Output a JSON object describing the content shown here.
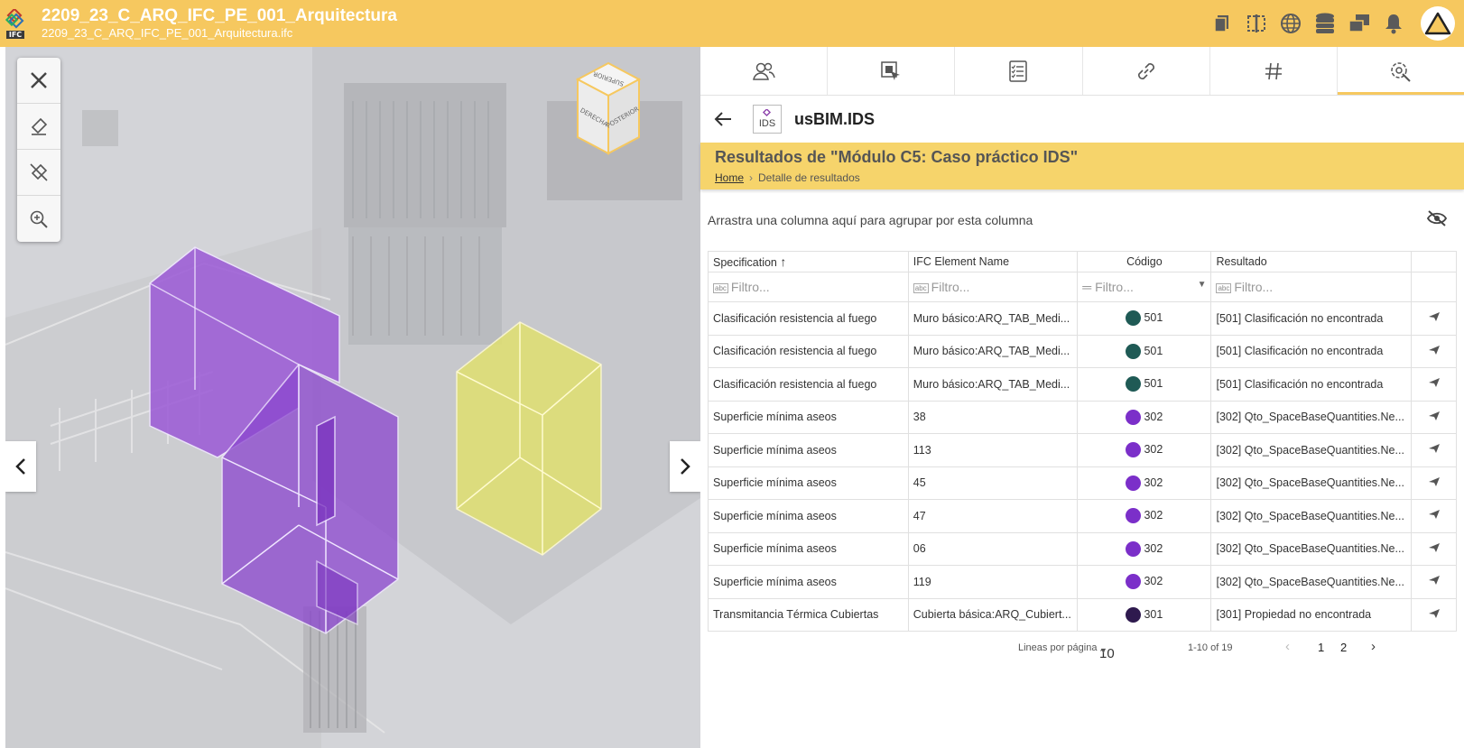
{
  "header": {
    "title": "2209_23_C_ARQ_IFC_PE_001_Arquitectura",
    "subtitle": "2209_23_C_ARQ_IFC_PE_001_Arquitectura.ifc",
    "logo_tag": "IFC",
    "icons": [
      "files-icon",
      "compare-icon",
      "globe-icon",
      "database-icon",
      "windows-icon",
      "bell-icon",
      "warning-avatar-icon"
    ]
  },
  "viewer": {
    "tools": [
      "close-icon",
      "highlighter-icon",
      "highlighter-off-icon",
      "zoom-in-icon"
    ],
    "navcube": {
      "top": "SUPERIOR",
      "left": "DERECHA",
      "right": "POSTERIOR"
    },
    "colors": {
      "purple": "#9b59d6",
      "yellow": "#e0e070"
    }
  },
  "panel": {
    "tabs": [
      "users-icon",
      "select-icon",
      "checklist-icon",
      "link-icon",
      "hash-icon",
      "settings-icon"
    ],
    "app_name": "usBIM.IDS",
    "ids_label": "IDS",
    "results_title": "Resultados de \"Módulo C5: Caso práctico IDS\"",
    "breadcrumb": {
      "home": "Home",
      "current": "Detalle de resultados"
    },
    "group_hint": "Arrastra una columna aquí para agrupar por esta columna",
    "columns": [
      "Specification",
      "IFC Element Name",
      "Código",
      "Resultado"
    ],
    "filter_placeholder": "Filtro...",
    "rows": [
      {
        "spec": "Clasificación resistencia al fuego",
        "element": "Muro básico:ARQ_TAB_Medi...",
        "color": "#1f5a55",
        "code": "501",
        "result": "[501] Clasificación no encontrada"
      },
      {
        "spec": "Clasificación resistencia al fuego",
        "element": "Muro básico:ARQ_TAB_Medi...",
        "color": "#1f5a55",
        "code": "501",
        "result": "[501] Clasificación no encontrada"
      },
      {
        "spec": "Clasificación resistencia al fuego",
        "element": "Muro básico:ARQ_TAB_Medi...",
        "color": "#1f5a55",
        "code": "501",
        "result": "[501] Clasificación no encontrada"
      },
      {
        "spec": "Superficie mínima aseos",
        "element": "38",
        "color": "#7b2fc9",
        "code": "302",
        "result": "[302] Qto_SpaceBaseQuantities.Ne..."
      },
      {
        "spec": "Superficie mínima aseos",
        "element": "113",
        "color": "#7b2fc9",
        "code": "302",
        "result": "[302] Qto_SpaceBaseQuantities.Ne..."
      },
      {
        "spec": "Superficie mínima aseos",
        "element": "45",
        "color": "#7b2fc9",
        "code": "302",
        "result": "[302] Qto_SpaceBaseQuantities.Ne..."
      },
      {
        "spec": "Superficie mínima aseos",
        "element": "47",
        "color": "#7b2fc9",
        "code": "302",
        "result": "[302] Qto_SpaceBaseQuantities.Ne..."
      },
      {
        "spec": "Superficie mínima aseos",
        "element": "06",
        "color": "#7b2fc9",
        "code": "302",
        "result": "[302] Qto_SpaceBaseQuantities.Ne..."
      },
      {
        "spec": "Superficie mínima aseos",
        "element": "119",
        "color": "#7b2fc9",
        "code": "302",
        "result": "[302] Qto_SpaceBaseQuantities.Ne..."
      },
      {
        "spec": "Transmitancia Térmica Cubiertas",
        "element": "Cubierta básica:ARQ_Cubiert...",
        "color": "#2e1a4e",
        "code": "301",
        "result": "[301] Propiedad no encontrada"
      }
    ],
    "pager": {
      "label": "Lineas por página",
      "size": "10",
      "range": "1-10 of 19",
      "pages": [
        "1",
        "2"
      ]
    }
  }
}
